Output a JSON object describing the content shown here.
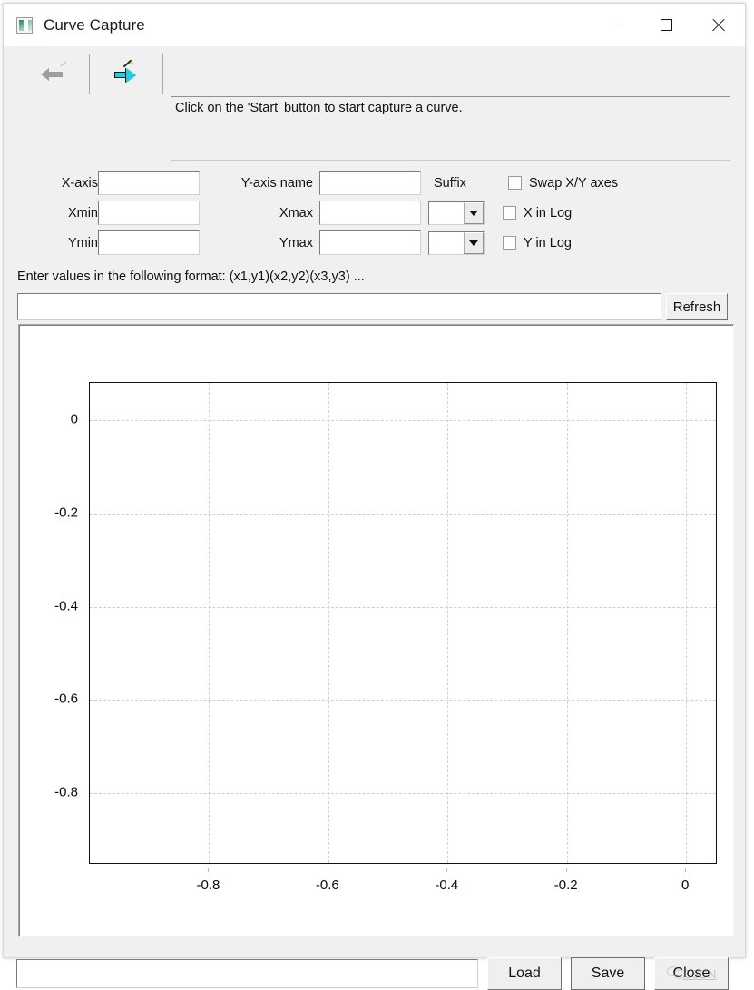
{
  "window": {
    "title": "Curve Capture",
    "icon": "image-chart-icon",
    "controls": {
      "minimize": "minimize-icon",
      "maximize": "maximize-icon",
      "close": "close-icon"
    }
  },
  "toolbar": {
    "back_label": "back-arrow-icon",
    "forward_label": "magic-wand-forward-arrow-icon"
  },
  "instruction": {
    "text": "Click on the 'Start' button to start capture a curve."
  },
  "form": {
    "x_axis_label": "X-axis",
    "x_axis_value": "",
    "y_axis_label": "Y-axis name",
    "y_axis_value": "",
    "xmin_label": "Xmin",
    "xmin_value": "",
    "xmax_label": "Xmax",
    "xmax_value": "",
    "ymin_label": "Ymin",
    "ymin_value": "",
    "ymax_label": "Ymax",
    "ymax_value": "",
    "suffix_label": "Suffix",
    "suffix_x_value": "",
    "suffix_y_value": "",
    "checkboxes": [
      {
        "label": "Swap X/Y axes",
        "checked": false
      },
      {
        "label": "X in Log",
        "checked": false
      },
      {
        "label": "Y in Log",
        "checked": false
      }
    ]
  },
  "values": {
    "hint": "Enter values in the following format:  (x1,y1)(x2,y2)(x3,y3) ...",
    "input_value": "",
    "refresh_label": "Refresh"
  },
  "bottom": {
    "path_value": "",
    "load_label": "Load",
    "save_label": "Save",
    "close_label": "Close",
    "watermark_text": "CSDN"
  },
  "chart_data": {
    "type": "scatter",
    "title": "",
    "xlabel": "",
    "ylabel": "",
    "x": [],
    "y": [],
    "series": [],
    "xlim": [
      -1.0,
      0.05
    ],
    "ylim": [
      -0.95,
      0.08
    ],
    "xticks": [
      -0.8,
      -0.6,
      -0.4,
      -0.2,
      0
    ],
    "xtick_labels": [
      "-0.8",
      "-0.6",
      "-0.4",
      "-0.2",
      "0"
    ],
    "yticks": [
      0,
      -0.2,
      -0.4,
      -0.6,
      -0.8
    ],
    "ytick_labels": [
      "0",
      "-0.2",
      "-0.4",
      "-0.6",
      "-0.8"
    ],
    "grid": true,
    "grid_style": "dashed",
    "legend": null,
    "empty": true
  }
}
